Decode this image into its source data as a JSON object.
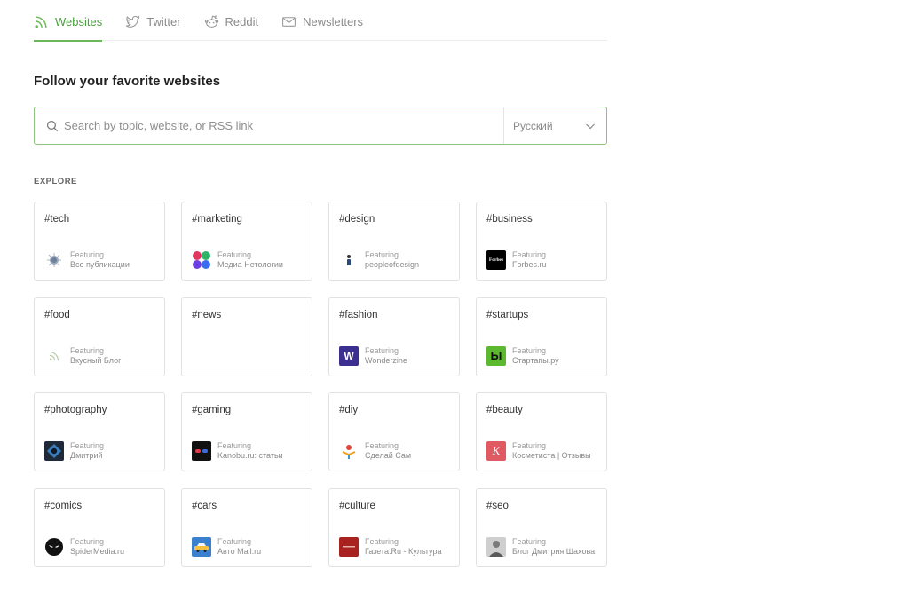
{
  "tabs": [
    {
      "label": "Websites",
      "icon": "rss-icon",
      "active": true
    },
    {
      "label": "Twitter",
      "icon": "twitter-icon",
      "active": false
    },
    {
      "label": "Reddit",
      "icon": "reddit-icon",
      "active": false
    },
    {
      "label": "Newsletters",
      "icon": "mail-icon",
      "active": false
    }
  ],
  "title": "Follow your favorite websites",
  "search": {
    "placeholder": "Search by topic, website, or RSS link",
    "value": ""
  },
  "language": {
    "selected": "Русский"
  },
  "explore_label": "EXPLORE",
  "featuring_label": "Featuring",
  "accent_color": "#6bb85a",
  "cards": [
    {
      "tag": "#tech",
      "site": "Все публикации"
    },
    {
      "tag": "#marketing",
      "site": "Медиа Нетологии"
    },
    {
      "tag": "#design",
      "site": "peopleofdesign"
    },
    {
      "tag": "#business",
      "site": "Forbes.ru",
      "icon_text": "Forbes"
    },
    {
      "tag": "#food",
      "site": "Вкусный Блог"
    },
    {
      "tag": "#news"
    },
    {
      "tag": "#fashion",
      "site": "Wonderzine",
      "icon_text": "W"
    },
    {
      "tag": "#startups",
      "site": "Стартапы.ру",
      "icon_text": "Ы"
    },
    {
      "tag": "#photography",
      "site": "Дмитрий"
    },
    {
      "tag": "#gaming",
      "site": "Kanobu.ru: статьи"
    },
    {
      "tag": "#diy",
      "site": "Сделай Сам"
    },
    {
      "tag": "#beauty",
      "site": "Косметиста | Отзывы",
      "icon_text": "K"
    },
    {
      "tag": "#comics",
      "site": "SpiderMedia.ru"
    },
    {
      "tag": "#cars",
      "site": "Авто Mail.ru"
    },
    {
      "tag": "#culture",
      "site": "Газета.Ru - Культура"
    },
    {
      "tag": "#seo",
      "site": "Блог Дмитрия Шахова"
    }
  ]
}
